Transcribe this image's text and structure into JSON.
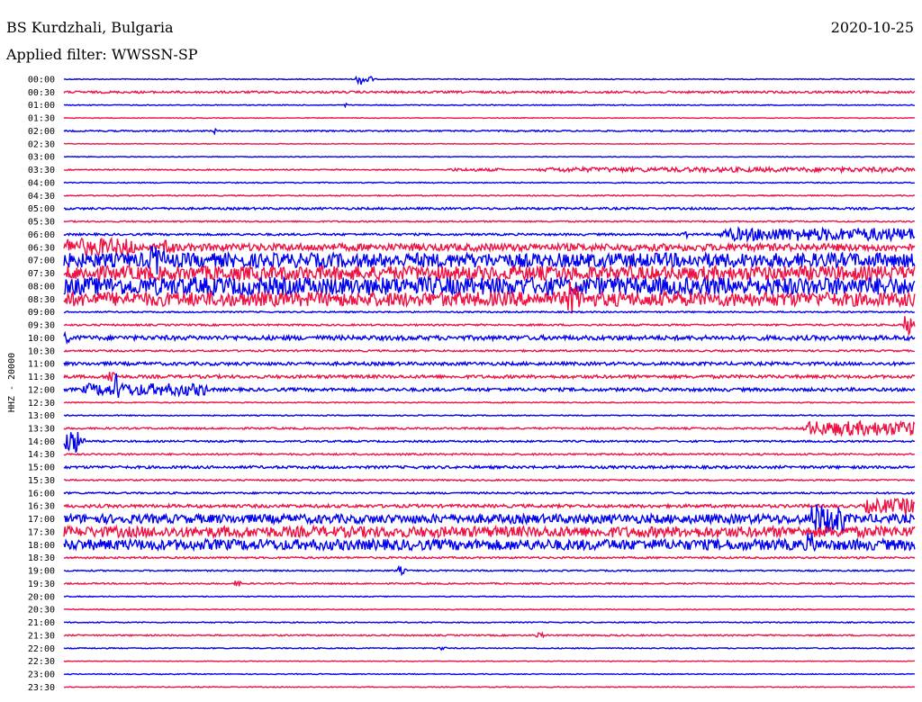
{
  "header": {
    "station": "BS Kurdzhali, Bulgaria",
    "date": "2020-10-25",
    "filter": "Applied filter: WWSSN-SP"
  },
  "chart_data": {
    "type": "line",
    "title": "BS Kurdzhali, Bulgaria",
    "channel_label": "HHZ - 20000",
    "row_labels": [
      "00:00",
      "00:30",
      "01:00",
      "01:30",
      "02:00",
      "02:30",
      "03:00",
      "03:30",
      "04:00",
      "04:30",
      "05:00",
      "05:30",
      "06:00",
      "06:30",
      "07:00",
      "07:30",
      "08:00",
      "08:30",
      "09:00",
      "09:30",
      "10:00",
      "10:30",
      "11:00",
      "11:30",
      "12:00",
      "12:30",
      "13:00",
      "13:30",
      "14:00",
      "14:30",
      "15:00",
      "15:30",
      "16:00",
      "16:30",
      "17:00",
      "17:30",
      "18:00",
      "18:30",
      "19:00",
      "19:30",
      "20:00",
      "20:30",
      "21:00",
      "21:30",
      "22:00",
      "22:30",
      "23:00",
      "23:30"
    ],
    "series_colors": [
      "#0000ee",
      "#ee1144"
    ],
    "x_range_minutes": [
      0,
      30
    ],
    "row_activity": [
      {
        "base": 0.5,
        "events": [
          [
            10.3,
            0.7,
            6
          ]
        ]
      },
      {
        "base": 1.2,
        "events": []
      },
      {
        "base": 0.5,
        "events": [
          [
            9.9,
            0.1,
            2
          ]
        ]
      },
      {
        "base": 0.4,
        "events": []
      },
      {
        "base": 0.8,
        "events": [
          [
            5.3,
            0.1,
            3
          ]
        ]
      },
      {
        "base": 0.4,
        "events": []
      },
      {
        "base": 0.4,
        "events": []
      },
      {
        "base": 0.6,
        "events": [
          [
            13.5,
            2.0,
            1
          ],
          [
            16.5,
            13.5,
            2
          ]
        ]
      },
      {
        "base": 0.6,
        "events": []
      },
      {
        "base": 0.6,
        "events": []
      },
      {
        "base": 1.2,
        "events": []
      },
      {
        "base": 0.8,
        "events": []
      },
      {
        "base": 1.2,
        "events": [
          [
            21.8,
            0.2,
            9
          ],
          [
            23.0,
            8.5,
            6
          ]
        ]
      },
      {
        "base": 4.0,
        "events": [
          [
            0,
            2.5,
            6
          ],
          [
            3.5,
            0.5,
            5
          ]
        ]
      },
      {
        "base": 8.0,
        "events": [
          [
            3.0,
            0.6,
            10
          ]
        ]
      },
      {
        "base": 8.0,
        "events": []
      },
      {
        "base": 10.0,
        "events": []
      },
      {
        "base": 8.0,
        "events": [
          [
            17.7,
            0.6,
            12
          ]
        ]
      },
      {
        "base": 0.8,
        "events": []
      },
      {
        "base": 1.0,
        "events": [
          [
            29.6,
            0.4,
            12
          ]
        ]
      },
      {
        "base": 2.5,
        "events": [
          [
            0,
            0.2,
            8
          ]
        ]
      },
      {
        "base": 1.0,
        "events": []
      },
      {
        "base": 1.8,
        "events": []
      },
      {
        "base": 1.8,
        "events": [
          [
            1.5,
            0.4,
            8
          ]
        ]
      },
      {
        "base": 1.8,
        "events": [
          [
            0.6,
            4.5,
            5
          ],
          [
            1.8,
            0.3,
            20
          ]
        ]
      },
      {
        "base": 0.6,
        "events": []
      },
      {
        "base": 0.6,
        "events": []
      },
      {
        "base": 1.0,
        "events": [
          [
            26.0,
            4.0,
            7
          ]
        ]
      },
      {
        "base": 1.0,
        "events": [
          [
            0,
            0.8,
            14
          ]
        ]
      },
      {
        "base": 1.0,
        "events": []
      },
      {
        "base": 1.5,
        "events": []
      },
      {
        "base": 0.8,
        "events": []
      },
      {
        "base": 1.0,
        "events": []
      },
      {
        "base": 1.8,
        "events": [
          [
            28.2,
            1.8,
            6
          ],
          [
            29.6,
            0.4,
            10
          ]
        ]
      },
      {
        "base": 5.0,
        "events": [
          [
            26.3,
            1.2,
            12
          ]
        ]
      },
      {
        "base": 6.0,
        "events": []
      },
      {
        "base": 6.0,
        "events": [
          [
            26.2,
            0.3,
            10
          ]
        ]
      },
      {
        "base": 1.0,
        "events": []
      },
      {
        "base": 0.8,
        "events": [
          [
            11.7,
            0.4,
            4
          ]
        ]
      },
      {
        "base": 0.8,
        "events": [
          [
            6.0,
            0.3,
            3
          ]
        ]
      },
      {
        "base": 0.5,
        "events": []
      },
      {
        "base": 0.5,
        "events": []
      },
      {
        "base": 0.6,
        "events": []
      },
      {
        "base": 0.8,
        "events": [
          [
            16.6,
            0.4,
            3
          ]
        ]
      },
      {
        "base": 0.6,
        "events": [
          [
            13.2,
            0.3,
            2
          ]
        ]
      },
      {
        "base": 0.4,
        "events": []
      },
      {
        "base": 0.5,
        "events": []
      },
      {
        "base": 0.5,
        "events": []
      }
    ]
  }
}
